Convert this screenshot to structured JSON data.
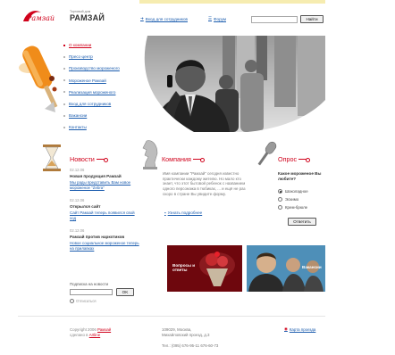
{
  "header": {
    "logo_text": "Рамзай",
    "brand_subtitle": "Торговый дом",
    "brand_name": "РАМЗАЙ",
    "staff_login": "Вход для сотрудников",
    "forum": "Форум",
    "search_placeholder": "",
    "search_button": "Найти"
  },
  "nav": {
    "items": [
      {
        "label": "О компании",
        "active": true
      },
      {
        "label": "Пресс-центр",
        "active": false
      },
      {
        "label": "Производство мороженого",
        "active": false
      },
      {
        "label": "Мороженое Рамзай",
        "active": false
      },
      {
        "label": "Реализация мороженого",
        "active": false
      },
      {
        "label": "Вход для сотрудников",
        "active": false
      },
      {
        "label": "Вакансии",
        "active": false
      },
      {
        "label": "Контакты",
        "active": false
      }
    ]
  },
  "news": {
    "heading": "Новости",
    "items": [
      {
        "date": "02.12.06",
        "title": "Новая продукция Рамзай",
        "link": "Мы рады представить Вам новое мороженое \"Zebra\""
      },
      {
        "date": "02.12.06",
        "title": "Открылся сайт",
        "link": "Сайт Рамзай теперь появился свой ход"
      },
      {
        "date": "02.12.06",
        "title": "Рамзай против наркотиков",
        "link": "Новое социальное мороженое теперь на прилавках"
      }
    ],
    "subscribe_label": "Подписка на новости",
    "subscribe_button": "OK",
    "unsubscribe": "Отписаться"
  },
  "company": {
    "heading": "Компания",
    "text": "Имя компании \"Рамзай\" сегодня известно практически каждому жителю. Но мало кто знает, что этот бытовой ребенок с названием одного персонажа в тюбиках, ... и ещё не раз скоро в стране Вы увидите форму.",
    "more": "Узнать подробнее"
  },
  "poll": {
    "heading": "Опрос",
    "question": "Какое мороженое Вы любите?",
    "options": [
      {
        "label": "Шоколадное",
        "selected": true
      },
      {
        "label": "Эскимо",
        "selected": false
      },
      {
        "label": "Крем-брюле",
        "selected": false
      }
    ],
    "answer_button": "Ответить"
  },
  "banners": {
    "ad1_text": "Вопросы и ответы",
    "ad2_text": "Вакансии"
  },
  "footer": {
    "copyright_line1": "Copyright 2006",
    "copyright_link1": "Рамзай",
    "copyright_line2": "сделано в",
    "copyright_link2": "Artline",
    "address_line1": "109029, Москва,",
    "address_line2": "Михайловский проезд, д.3",
    "phone": "Тел.: (095) 676-95-11 676-60-73",
    "sitemap": "Карта проезда"
  },
  "colors": {
    "accent": "#d0021b",
    "link": "#1b5cae"
  }
}
